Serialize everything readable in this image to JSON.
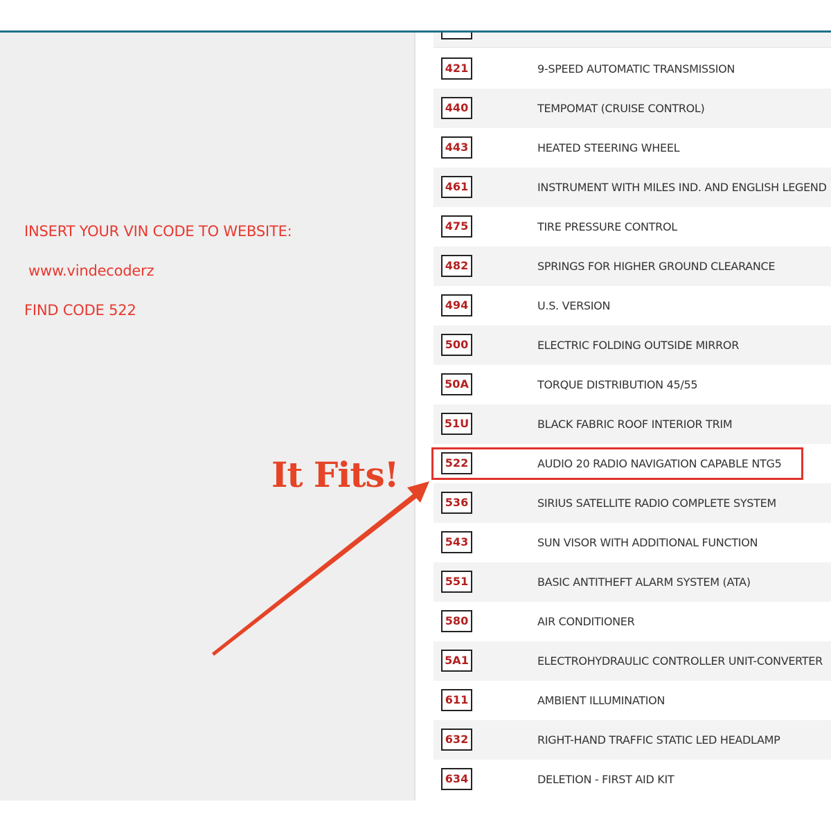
{
  "instructions": {
    "line1": "INSERT YOUR VIN CODE TO WEBSITE:",
    "line2": "www.vindecoderz",
    "line3": "FIND CODE 522"
  },
  "annotation": {
    "label": "It Fits!",
    "color": "#e54427",
    "highlighted_code": "522"
  },
  "colors": {
    "accent_line": "#1f6f8b",
    "instruction_text": "#e8382f",
    "code_text": "#b3201f"
  },
  "codes": [
    {
      "code": "421",
      "description": "9-SPEED AUTOMATIC TRANSMISSION"
    },
    {
      "code": "440",
      "description": "TEMPOMAT (CRUISE CONTROL)"
    },
    {
      "code": "443",
      "description": "HEATED STEERING WHEEL"
    },
    {
      "code": "461",
      "description": "INSTRUMENT WITH MILES IND. AND ENGLISH LEGEND"
    },
    {
      "code": "475",
      "description": "TIRE PRESSURE CONTROL"
    },
    {
      "code": "482",
      "description": "SPRINGS FOR HIGHER GROUND CLEARANCE"
    },
    {
      "code": "494",
      "description": "U.S. VERSION"
    },
    {
      "code": "500",
      "description": "ELECTRIC FOLDING OUTSIDE MIRROR"
    },
    {
      "code": "50A",
      "description": "TORQUE DISTRIBUTION 45/55"
    },
    {
      "code": "51U",
      "description": "BLACK FABRIC ROOF INTERIOR TRIM"
    },
    {
      "code": "522",
      "description": "AUDIO 20 RADIO NAVIGATION CAPABLE NTG5"
    },
    {
      "code": "536",
      "description": "SIRIUS SATELLITE RADIO COMPLETE SYSTEM"
    },
    {
      "code": "543",
      "description": "SUN VISOR WITH ADDITIONAL FUNCTION"
    },
    {
      "code": "551",
      "description": "BASIC ANTITHEFT ALARM SYSTEM (ATA)"
    },
    {
      "code": "580",
      "description": "AIR CONDITIONER"
    },
    {
      "code": "5A1",
      "description": "ELECTROHYDRAULIC CONTROLLER UNIT-CONVERTER"
    },
    {
      "code": "611",
      "description": "AMBIENT ILLUMINATION"
    },
    {
      "code": "632",
      "description": "RIGHT-HAND TRAFFIC STATIC LED HEADLAMP"
    },
    {
      "code": "634",
      "description": "DELETION - FIRST AID KIT"
    }
  ]
}
